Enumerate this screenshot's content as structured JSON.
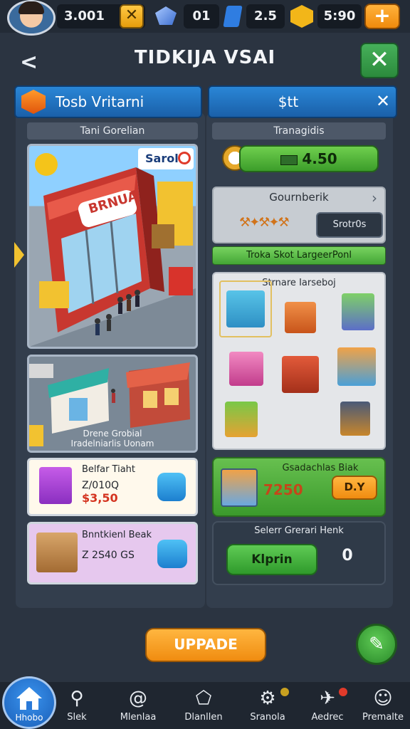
{
  "hud": {
    "coins": "3.001",
    "gems": "01",
    "energy": "2.5",
    "stars": "5:90",
    "cross_icon": "close-x",
    "plus_label": "+"
  },
  "header": {
    "title": "TIDKIJA VSAI",
    "back": "<",
    "close": "✕"
  },
  "left_tab": {
    "label": "Tosb Vritarni"
  },
  "right_tab": {
    "label": "$tt",
    "close": "✕"
  },
  "left_subhead": "Tani Gorelian",
  "right_subhead": "Tranagidis",
  "store_scene": {
    "badge": "Sarol",
    "sign": "BRNUA"
  },
  "street_scene": {
    "caption_line1": "Drene Grobial",
    "caption_line2": "Iradelniarlis Uonam"
  },
  "offer_1": {
    "title": "Belfar Tiaht",
    "line1": "Z/010Q",
    "price": "3,50"
  },
  "offer_2": {
    "title": "Bnntkienl Beak",
    "line1": "Z 2S40 GS"
  },
  "money_bar": {
    "value": "4.50"
  },
  "gear_panel": {
    "title": "Gournberik",
    "arrow": "›",
    "button": "Srotr0s"
  },
  "green_strip": "Troka Skot LargeerPonl",
  "item_grid": {
    "title": "Strnare Iarseboj"
  },
  "reward_box": {
    "title": "Gsadachlas Biak",
    "amount": "7250",
    "button": "D.Y"
  },
  "dark_box": {
    "title": "Selerr Grerari Henk",
    "button": "Klprin",
    "count": "0"
  },
  "update_button": "UPPADE",
  "edit_icon": "pencil",
  "nav": [
    {
      "label": "Hhobo",
      "icon": "home"
    },
    {
      "label": "Slek",
      "icon": "tool"
    },
    {
      "label": "Mlenlaa",
      "icon": "spiral"
    },
    {
      "label": "Dlanllen",
      "icon": "badge"
    },
    {
      "label": "Sranola",
      "icon": "gear"
    },
    {
      "label": "Aedrec",
      "icon": "map"
    },
    {
      "label": "Premalte",
      "icon": "smile"
    }
  ],
  "colors": {
    "bg": "#2b3441",
    "tab_blue": "#2a86d6",
    "green": "#4fb43e",
    "orange": "#f59a1a"
  }
}
